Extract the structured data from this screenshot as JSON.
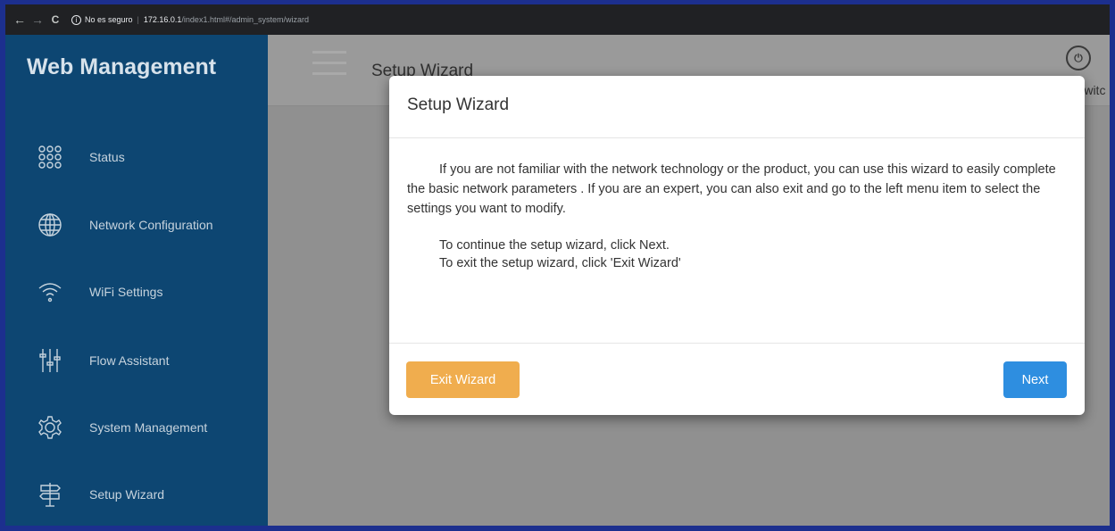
{
  "browser": {
    "back_glyph": "←",
    "forward_glyph": "→",
    "reload_glyph": "C",
    "info_glyph": "i",
    "security_label": "No es seguro",
    "separator": "|",
    "url_host": "172.16.0.1",
    "url_path": "/index1.html#/admin_system/wizard"
  },
  "sidebar": {
    "brand": "Web Management",
    "items": [
      {
        "label": "Status",
        "icon": "grid-dots-icon"
      },
      {
        "label": "Network Configuration",
        "icon": "globe-icon"
      },
      {
        "label": "WiFi Settings",
        "icon": "wifi-icon"
      },
      {
        "label": "Flow Assistant",
        "icon": "sliders-icon"
      },
      {
        "label": "System Management",
        "icon": "gear-icon"
      },
      {
        "label": "Setup Wizard",
        "icon": "signpost-icon"
      }
    ]
  },
  "header": {
    "title": "Setup Wizard",
    "power_glyph": "⏻",
    "switch_label": "Switc"
  },
  "modal": {
    "title": "Setup Wizard",
    "intro": "If you are not familiar with the network technology or the product, you can use this wizard to easily complete the basic network parameters . If you are an expert, you can also exit and go to the left menu item to select the settings you want to modify.",
    "step_next": "To continue the setup wizard, click Next.",
    "step_exit": "To exit the setup wizard, click 'Exit Wizard'",
    "exit_label": "Exit Wizard",
    "next_label": "Next"
  },
  "colors": {
    "sidebar_bg": "#0d4672",
    "exit_button": "#f0ad4e",
    "next_button": "#2e8ee0",
    "frame": "#1c2f8e"
  }
}
